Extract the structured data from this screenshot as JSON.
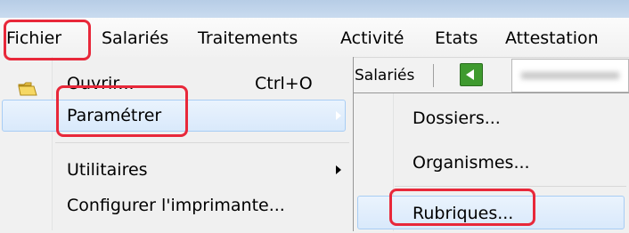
{
  "menubar": {
    "items": [
      "Fichier",
      "Salariés",
      "Traitements",
      "Activité",
      "Etats",
      "Attestation"
    ]
  },
  "toolbar": {
    "salaries_label": "Salariés"
  },
  "file_menu": {
    "ouvrir": {
      "label": "Ouvrir...",
      "shortcut": "Ctrl+O"
    },
    "parametrer": {
      "label": "Paramétrer"
    },
    "utilitaires": {
      "label": "Utilitaires"
    },
    "configurer": {
      "label": "Configurer l'imprimante..."
    }
  },
  "param_submenu": {
    "items": [
      "Dossiers...",
      "Organismes...",
      "Rubriques..."
    ]
  },
  "colors": {
    "highlight_red": "#e8283a",
    "selection_blue": "#d9e9fb",
    "back_button_green": "#3f9a2f"
  }
}
